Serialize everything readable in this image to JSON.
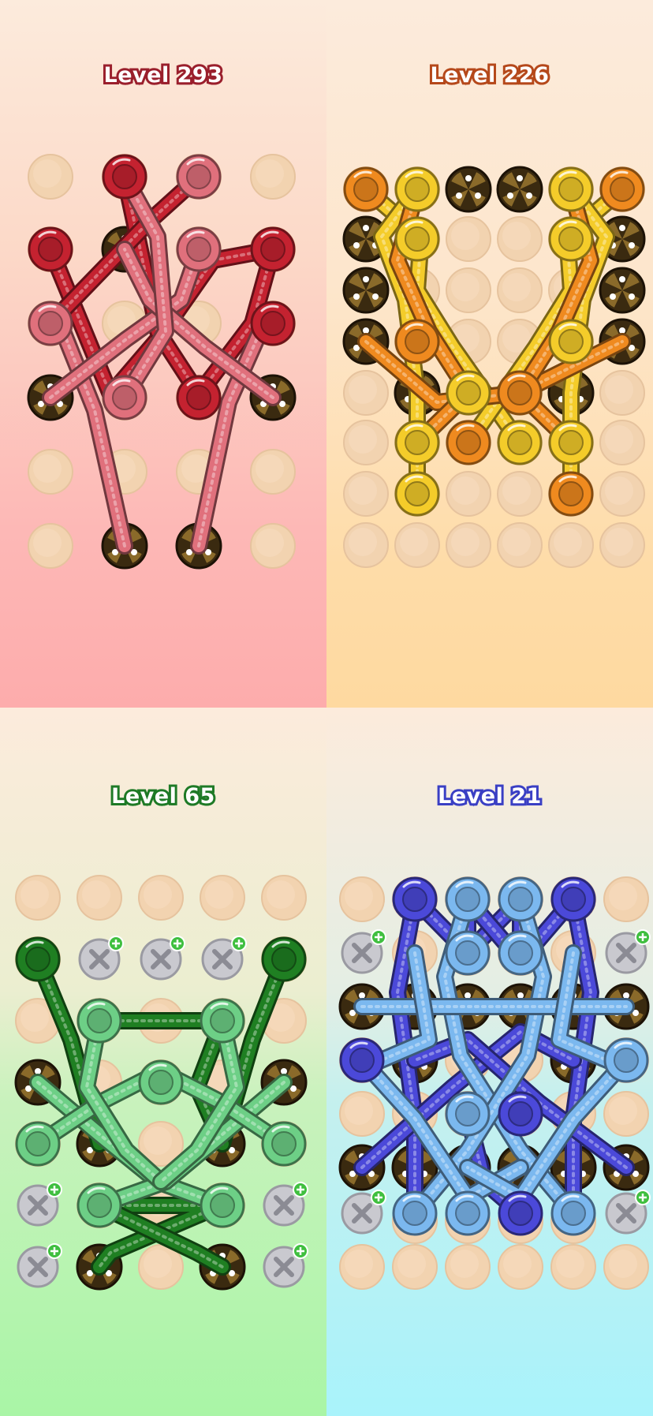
{
  "levels": [
    {
      "label": "Level 293",
      "title_color": "#9a1f2c",
      "rope_colors": [
        "#c42230",
        "#e0707c"
      ]
    },
    {
      "label": "Level 226",
      "title_color": "#b5481a",
      "rope_colors": [
        "#ef8a1f",
        "#f4cc2a"
      ]
    },
    {
      "label": "Level 65",
      "title_color": "#1e7a26",
      "rope_colors": [
        "#1f7f22",
        "#6dcf86"
      ]
    },
    {
      "label": "Level 21",
      "title_color": "#3a3fc4",
      "rope_colors": [
        "#4b49d9",
        "#7bb8ef"
      ]
    }
  ],
  "icons": {
    "peg": "peg-hole-icon",
    "screw": "screw-icon",
    "locked": "locked-peg-icon"
  }
}
